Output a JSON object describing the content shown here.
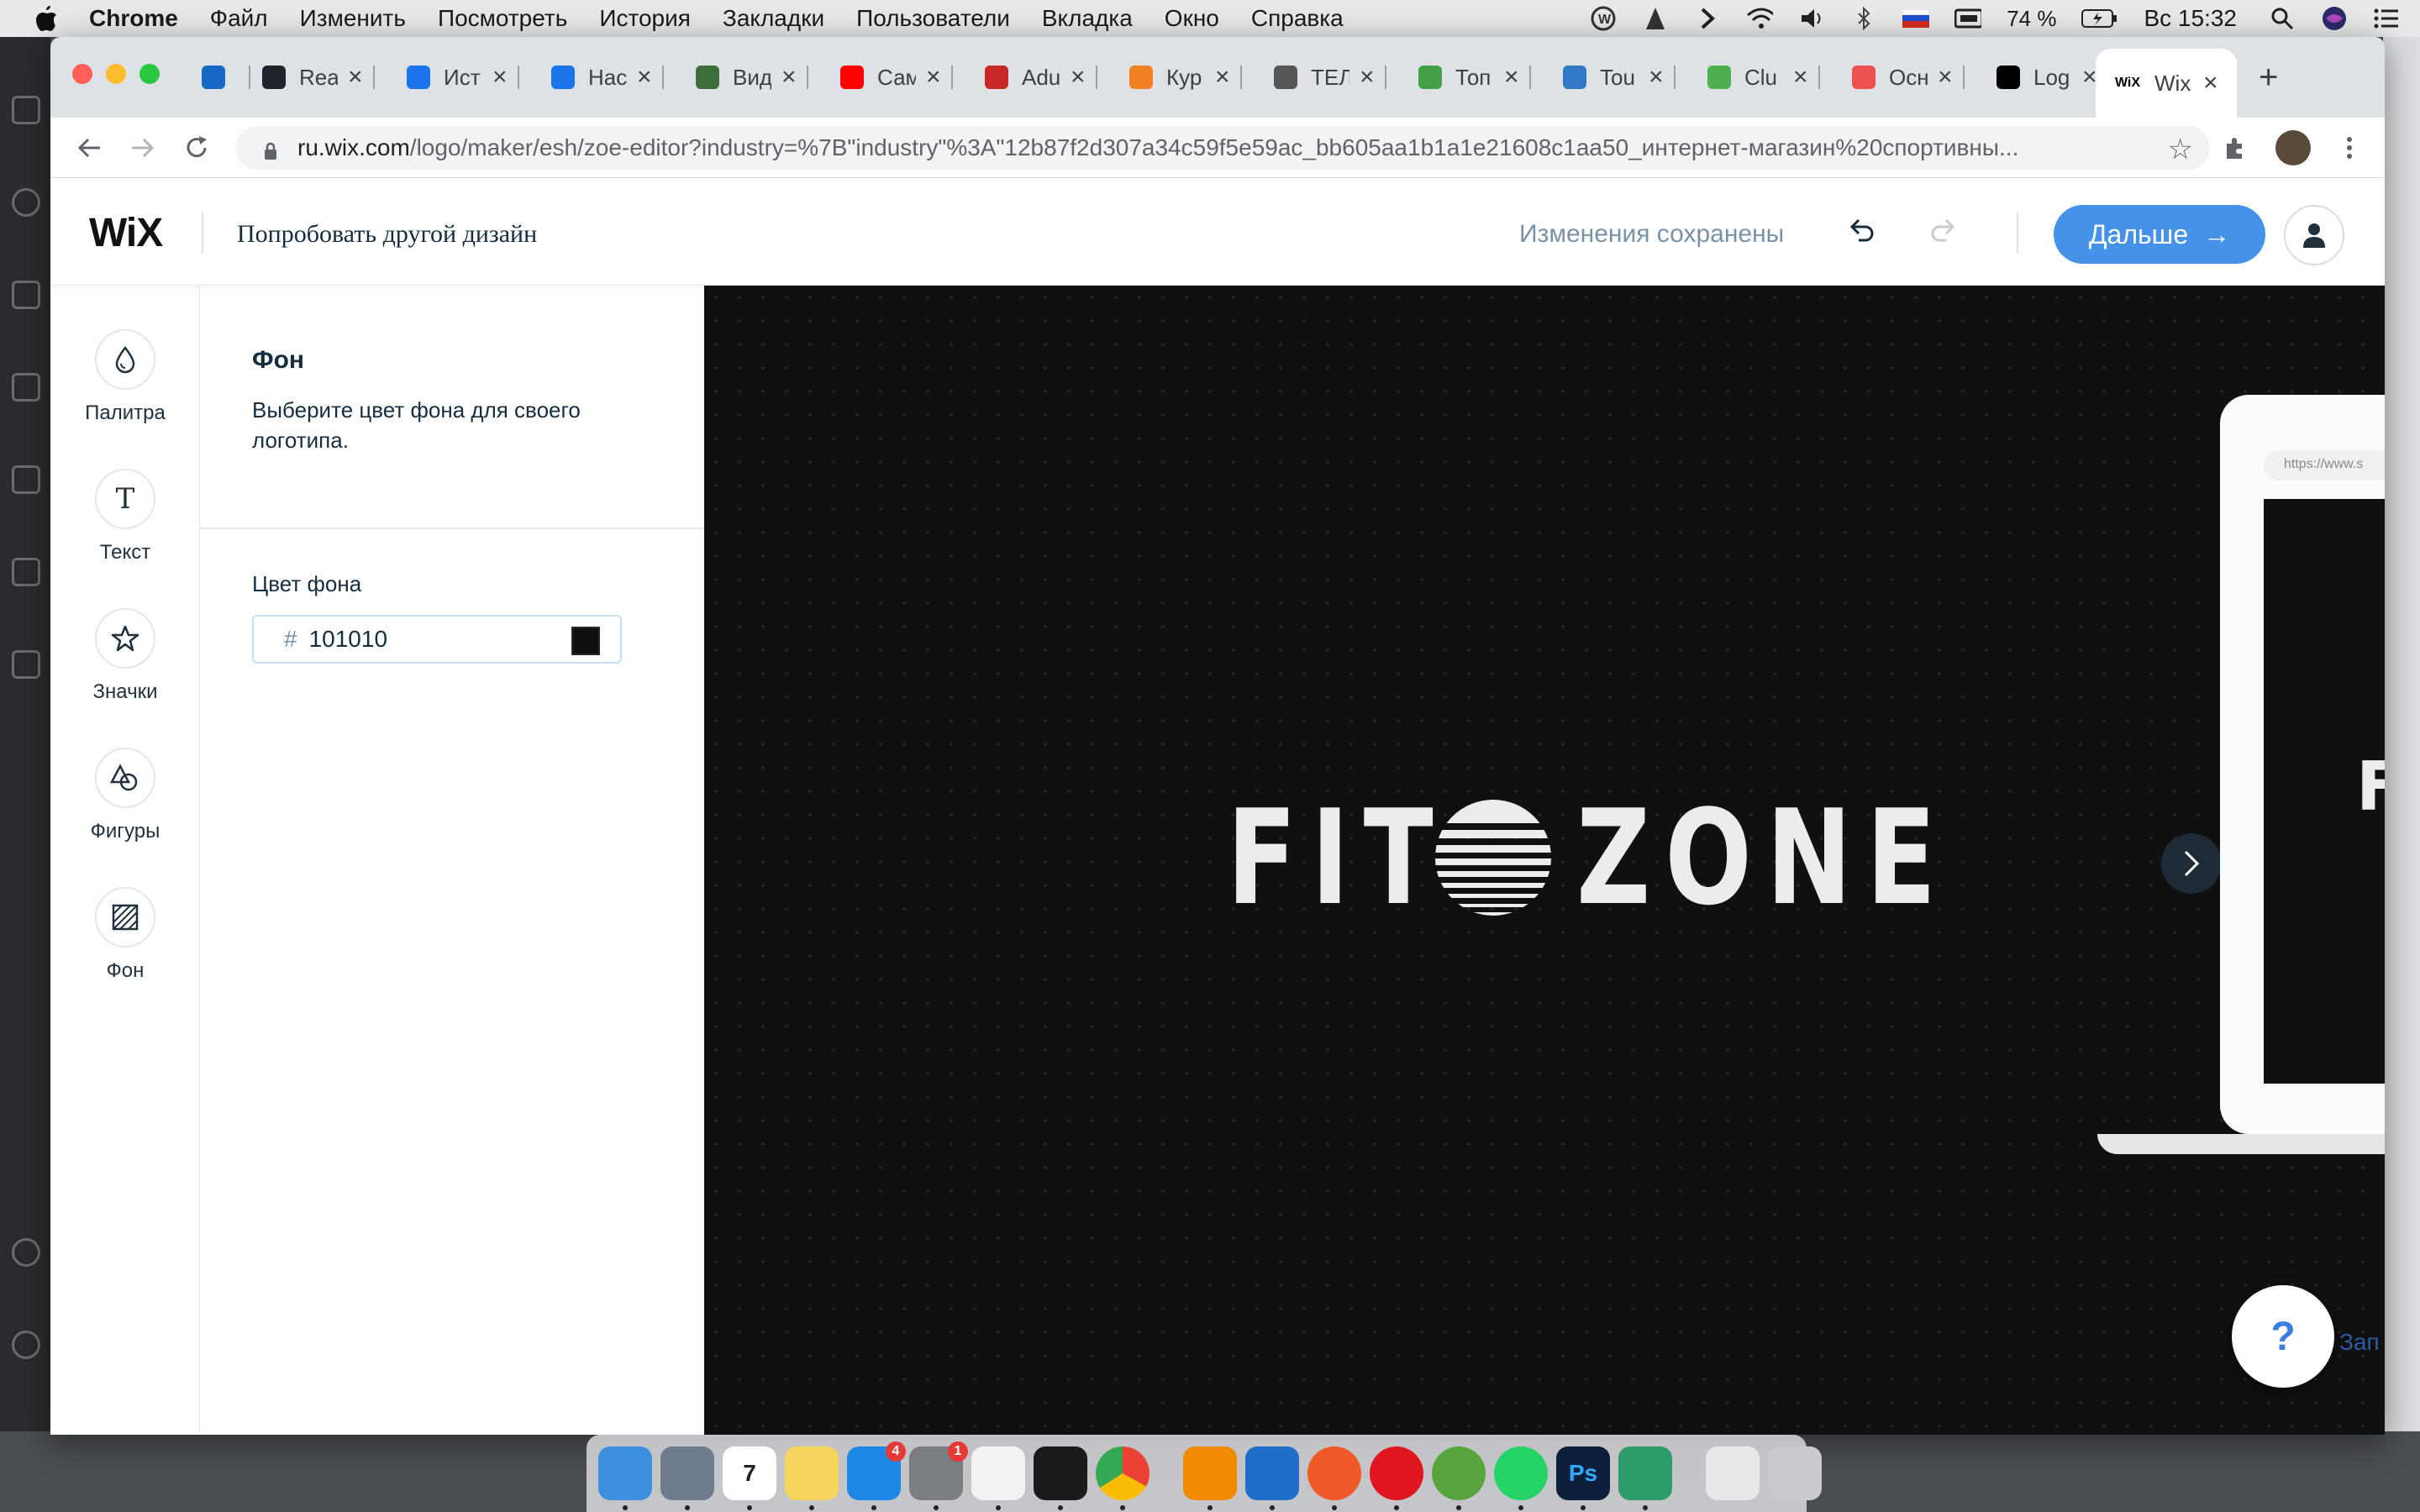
{
  "menubar": {
    "app": "Chrome",
    "items": [
      "Файл",
      "Изменить",
      "Посмотреть",
      "История",
      "Закладки",
      "Пользователи",
      "Вкладка",
      "Окно",
      "Справка"
    ],
    "battery": "74 %",
    "clock": "Вс 15:32"
  },
  "browser": {
    "tabs": [
      {
        "label": "",
        "icon": "vuetify-icon",
        "color": "#1867c0"
      },
      {
        "label": "Rea",
        "icon": "react-icon",
        "color": "#20232a"
      },
      {
        "label": "Ист",
        "icon": "history-icon",
        "color": "#1a73e8"
      },
      {
        "label": "Нас",
        "icon": "gear-icon",
        "color": "#1a73e8"
      },
      {
        "label": "Вид",
        "icon": "image-icon",
        "color": "#3b6e3b"
      },
      {
        "label": "Сам",
        "icon": "youtube-icon",
        "color": "#ff0000"
      },
      {
        "label": "Adu",
        "icon": "adult-icon",
        "color": "#c62828"
      },
      {
        "label": "Кур",
        "icon": "stack-icon",
        "color": "#f48024"
      },
      {
        "label": "ТЕЛ",
        "icon": "globe-icon",
        "color": "#555555"
      },
      {
        "label": "Топ",
        "icon": "pencil-icon",
        "color": "#43a047"
      },
      {
        "label": "Tou",
        "icon": "typescript-icon",
        "color": "#3178c6"
      },
      {
        "label": "Clu",
        "icon": "leaf-icon",
        "color": "#4caf50"
      },
      {
        "label": "Осн",
        "icon": "udemy-icon",
        "color": "#ec5252"
      },
      {
        "label": "Log",
        "icon": "wix-icon",
        "color": "#000000"
      }
    ],
    "active_tab": {
      "label": "Wix",
      "icon": "wix-icon"
    },
    "url_host": "ru.wix.com",
    "url_path": "/logo/maker/esh/zoe-editor?industry=%7B\"industry\"%3A\"12b87f2d307a34c59f5e59ac_bb605aa1b1a1e21608c1aa50_интернет-магазин%20спортивны..."
  },
  "header": {
    "logo": "WiX",
    "try_other": "Попробовать другой дизайн",
    "saved_status": "Изменения сохранены",
    "next_button": "Дальше",
    "next_arrow": "→"
  },
  "rail": [
    {
      "label": "Палитра",
      "icon": "palette-drop-icon"
    },
    {
      "label": "Текст",
      "icon": "text-icon"
    },
    {
      "label": "Значки",
      "icon": "star-icon"
    },
    {
      "label": "Фигуры",
      "icon": "shapes-icon"
    },
    {
      "label": "Фон",
      "icon": "background-hatch-icon"
    }
  ],
  "panel": {
    "title": "Фон",
    "description": "Выберите цвет фона для своего логотипа.",
    "field_label": "Цвет фона",
    "hash": "#",
    "color_value": "101010"
  },
  "canvas": {
    "background": "#101010",
    "logo_left": "FIT",
    "logo_right": "ZONE",
    "laptop_url": "https://www.s",
    "laptop_letter": "F",
    "help": "?",
    "corner_text": "Зап"
  },
  "dock": [
    {
      "name": "finder",
      "color": "#3d8fe0"
    },
    {
      "name": "launchpad",
      "color": "#6d7b8c"
    },
    {
      "name": "calendar",
      "color": "#ffffff",
      "text": "7"
    },
    {
      "name": "notes",
      "color": "#f6d55c"
    },
    {
      "name": "appstore",
      "color": "#1e88e5",
      "badge": "4"
    },
    {
      "name": "system-preferences",
      "color": "#7a7d82",
      "badge": "1"
    },
    {
      "name": "textedit",
      "color": "#f2f2f2"
    },
    {
      "name": "terminal",
      "color": "#1b1b1b"
    },
    {
      "name": "chrome",
      "color": "#ffffff"
    },
    {
      "name": "vlc",
      "color": "#f18a00"
    },
    {
      "name": "vscode",
      "color": "#1e6fc7"
    },
    {
      "name": "paw",
      "color": "#f05a28"
    },
    {
      "name": "opera",
      "color": "#e0161f"
    },
    {
      "name": "utorrent",
      "color": "#58a53e"
    },
    {
      "name": "whatsapp",
      "color": "#25d366"
    },
    {
      "name": "photoshop",
      "color": "#0d1f3a",
      "text": "Ps"
    },
    {
      "name": "sketchbook",
      "color": "#2e9c6a"
    },
    {
      "name": "preview",
      "color": "#e8e8ea"
    },
    {
      "name": "trash",
      "color": "#c9cbcf"
    }
  ]
}
